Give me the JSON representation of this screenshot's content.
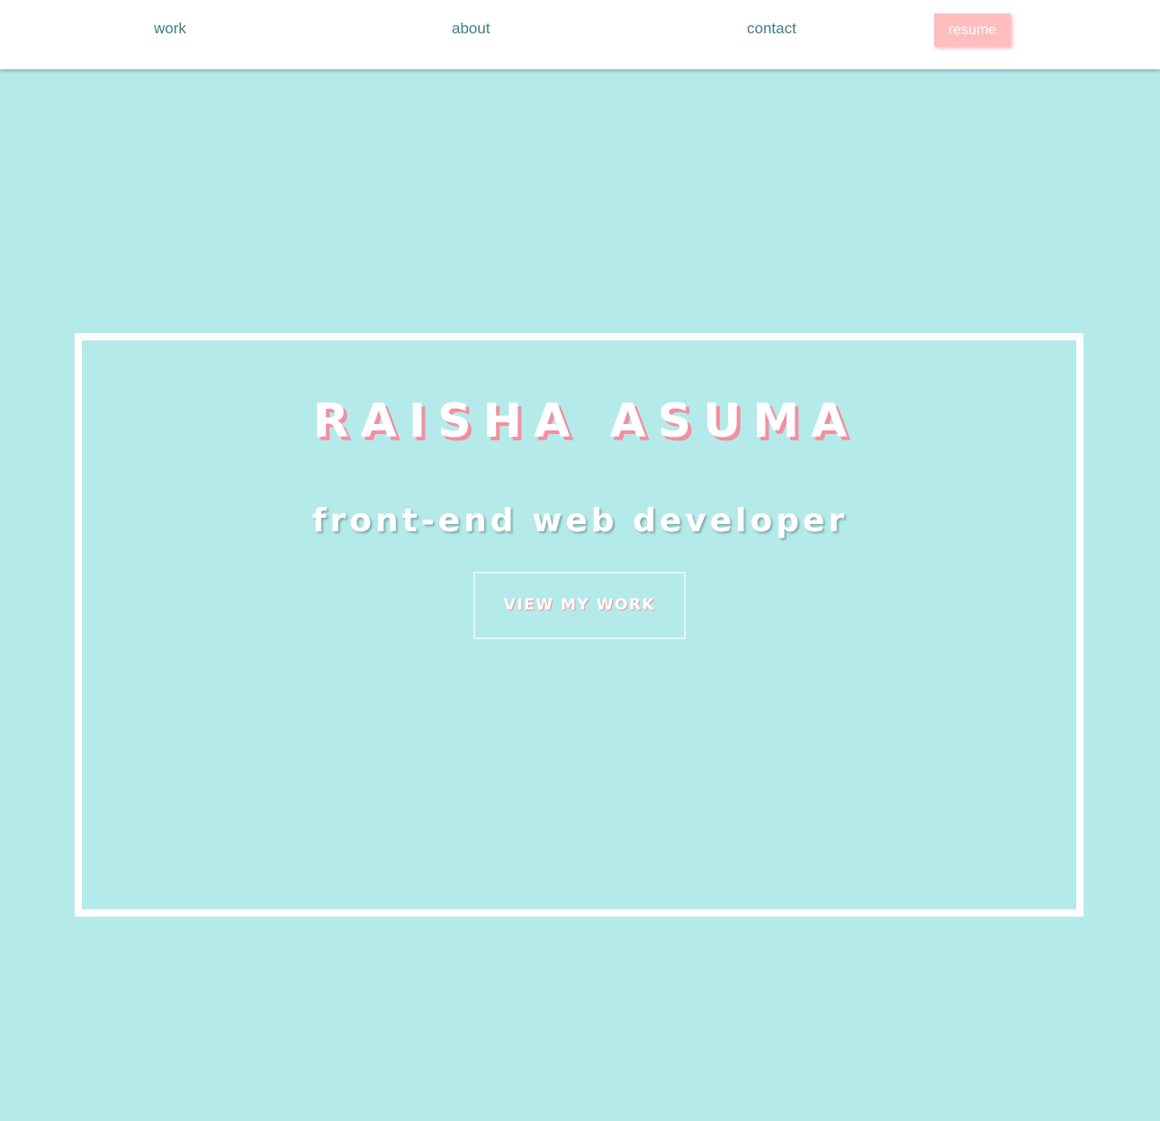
{
  "nav": {
    "work": "work",
    "about": "about",
    "contact": "contact",
    "resume": "resume"
  },
  "hero": {
    "name": "RAISHA ASUMA",
    "role": "front-end web developer",
    "cta": "VIEW MY WORK"
  },
  "colors": {
    "background": "#b4eae9",
    "nav_text": "#3f7f7a",
    "accent_pink": "#ffbdbd",
    "name_shadow": "#f28fa0",
    "frame": "#ffffff"
  }
}
